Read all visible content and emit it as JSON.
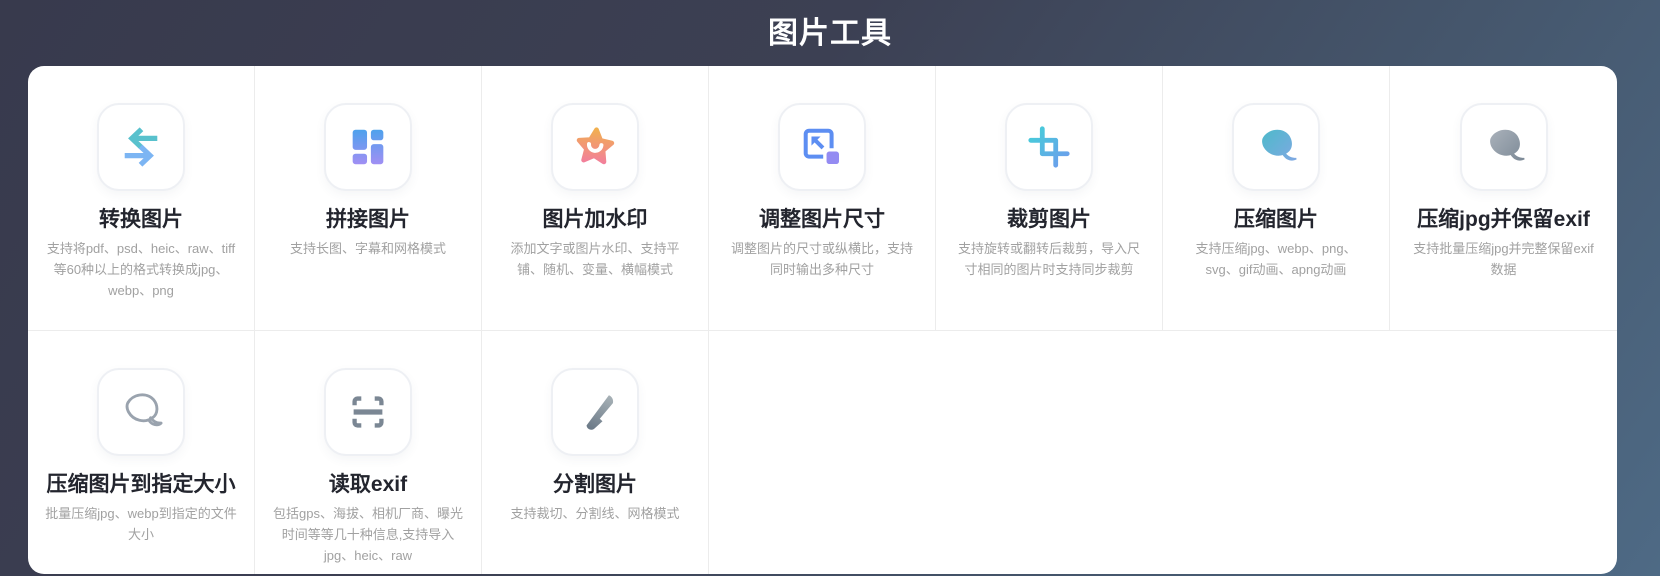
{
  "header": {
    "title": "图片工具"
  },
  "cards": [
    {
      "id": "convert-image",
      "title": "转换图片",
      "description": "支持将pdf、psd、heic、raw、tiff等60种以上的格式转换成jpg、webp、png",
      "icon": "convert-arrows-icon"
    },
    {
      "id": "stitch-image",
      "title": "拼接图片",
      "description": "支持长图、字幕和网格模式",
      "icon": "grid-collage-icon"
    },
    {
      "id": "watermark-image",
      "title": "图片加水印",
      "description": "添加文字或图片水印、支持平铺、随机、变量、横幅模式",
      "icon": "star-smile-icon"
    },
    {
      "id": "resize-image",
      "title": "调整图片尺寸",
      "description": "调整图片的尺寸或纵横比，支持同时输出多种尺寸",
      "icon": "resize-arrow-icon"
    },
    {
      "id": "crop-image",
      "title": "裁剪图片",
      "description": "支持旋转或翻转后裁剪，导入尺寸相同的图片时支持同步裁剪",
      "icon": "crop-icon"
    },
    {
      "id": "compress-image",
      "title": "压缩图片",
      "description": "支持压缩jpg、webp、png、svg、gif动画、apng动画",
      "icon": "leaf-teal-icon"
    },
    {
      "id": "compress-jpg-keep-exif",
      "title": "压缩jpg并保留exif",
      "description": "支持批量压缩jpg并完整保留exif数据",
      "icon": "leaf-gray-icon"
    },
    {
      "id": "compress-to-size",
      "title": "压缩图片到指定大小",
      "description": "批量压缩jpg、webp到指定的文件大小",
      "icon": "leaf-outline-icon"
    },
    {
      "id": "read-exif",
      "title": "读取exif",
      "description": "包括gps、海拔、相机厂商、曝光时间等等几十种信息,支持导入jpg、heic、raw",
      "icon": "scan-frame-icon"
    },
    {
      "id": "split-image",
      "title": "分割图片",
      "description": "支持裁切、分割线、网格模式",
      "icon": "knife-icon"
    }
  ],
  "colors": {
    "background_top": "#383a4d",
    "background_bottom": "#4e6a85",
    "panel": "#ffffff",
    "divider": "#ececec",
    "card_title": "#23252e",
    "card_description": "#a1a1a1",
    "accent_teal": "#58c1cd",
    "accent_blue": "#7cb5f3",
    "accent_indigo": "#5d8ef2",
    "accent_purple": "#a58ef4",
    "accent_orange": "#f1b14d",
    "accent_pink": "#f27d9f",
    "accent_gray": "#8d98a5"
  }
}
